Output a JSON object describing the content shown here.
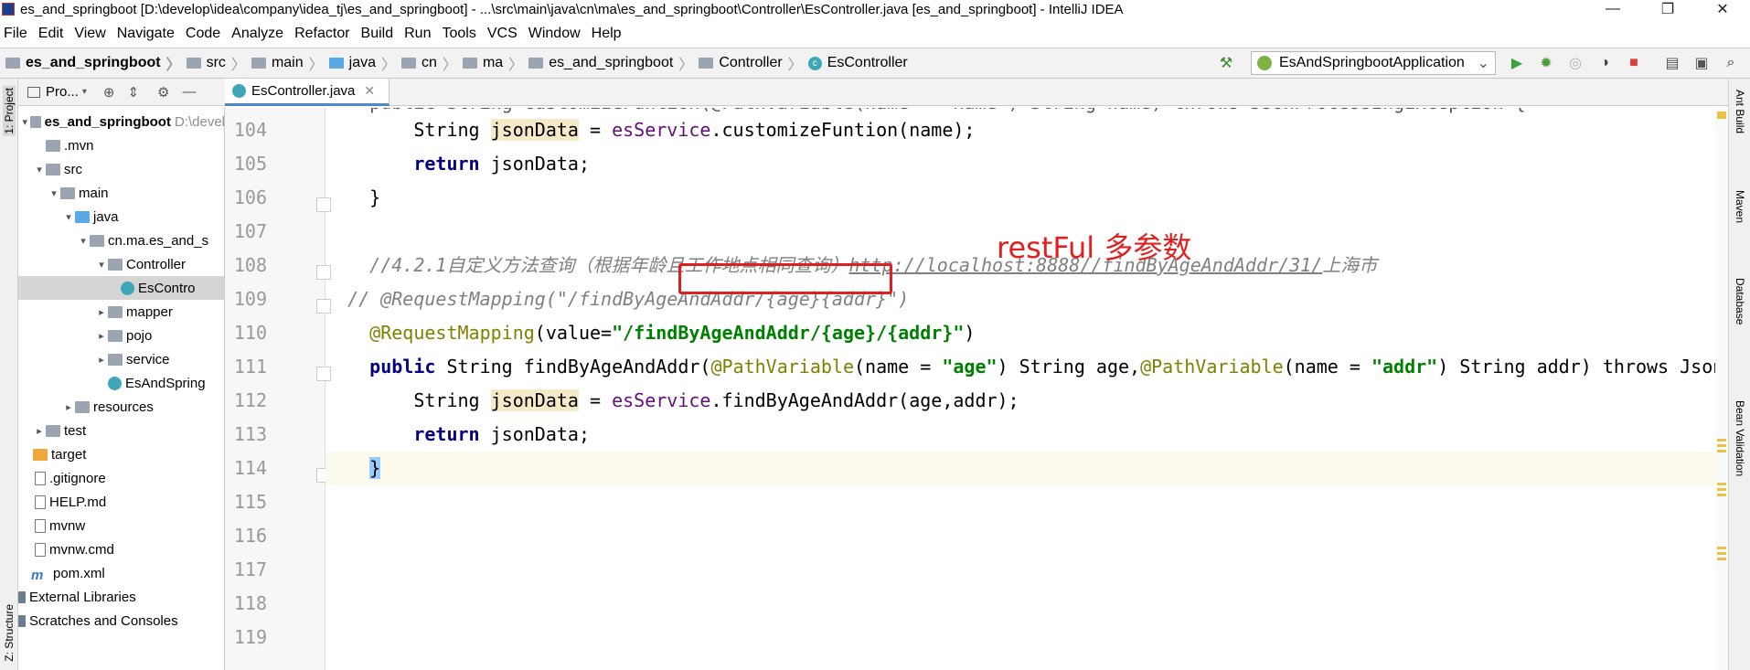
{
  "window": {
    "title": "es_and_springboot [D:\\develop\\idea\\company\\idea_tj\\es_and_springboot] - ...\\src\\main\\java\\cn\\ma\\es_and_springboot\\Controller\\EsController.java [es_and_springboot] - IntelliJ IDEA",
    "minimize": "—",
    "maximize": "❐",
    "close": "✕"
  },
  "menu": [
    "File",
    "Edit",
    "View",
    "Navigate",
    "Code",
    "Analyze",
    "Refactor",
    "Build",
    "Run",
    "Tools",
    "VCS",
    "Window",
    "Help"
  ],
  "breadcrumb": [
    "es_and_springboot",
    "src",
    "main",
    "java",
    "cn",
    "ma",
    "es_and_springboot",
    "Controller",
    "EsController"
  ],
  "run_config": "EsAndSpringbootApplication",
  "side_tabs": {
    "left_top": "1: Project",
    "left_bottom": "Z: Structure",
    "right": [
      "Ant Build",
      "Maven",
      "Database",
      "Bean Validation"
    ]
  },
  "project_panel": {
    "header": "Pro...",
    "tree": [
      {
        "label": "es_and_springboot",
        "extra": "D:\\devel",
        "level": 0,
        "icon": "folder",
        "arrow": "▾",
        "bold": true
      },
      {
        "label": ".mvn",
        "level": 1,
        "icon": "folder",
        "arrow": ""
      },
      {
        "label": "src",
        "level": 1,
        "icon": "folder",
        "arrow": "▾"
      },
      {
        "label": "main",
        "level": 2,
        "icon": "folder",
        "arrow": "▾"
      },
      {
        "label": "java",
        "level": 3,
        "icon": "folder-blue",
        "arrow": "▾"
      },
      {
        "label": "cn.ma.es_and_s",
        "level": 4,
        "icon": "folder",
        "arrow": "▾"
      },
      {
        "label": "Controller",
        "level": 5,
        "icon": "folder",
        "arrow": "▾"
      },
      {
        "label": "EsContro",
        "level": 6,
        "icon": "class",
        "arrow": "",
        "selected": true
      },
      {
        "label": "mapper",
        "level": 5,
        "icon": "folder",
        "arrow": "▸"
      },
      {
        "label": "pojo",
        "level": 5,
        "icon": "folder",
        "arrow": "▸"
      },
      {
        "label": "service",
        "level": 5,
        "icon": "folder",
        "arrow": "▸"
      },
      {
        "label": "EsAndSpring",
        "level": 5,
        "icon": "class",
        "arrow": ""
      },
      {
        "label": "resources",
        "level": 3,
        "icon": "folder",
        "arrow": "▸"
      },
      {
        "label": "test",
        "level": 2,
        "icon": "folder",
        "arrow": "▸"
      },
      {
        "label": "target",
        "level": 1,
        "icon": "folder-orange",
        "arrow": ""
      },
      {
        "label": ".gitignore",
        "level": 1,
        "icon": "file",
        "arrow": ""
      },
      {
        "label": "HELP.md",
        "level": 1,
        "icon": "file",
        "arrow": ""
      },
      {
        "label": "mvnw",
        "level": 1,
        "icon": "file",
        "arrow": ""
      },
      {
        "label": "mvnw.cmd",
        "level": 1,
        "icon": "file",
        "arrow": ""
      },
      {
        "label": "pom.xml",
        "level": 1,
        "icon": "maven",
        "arrow": ""
      },
      {
        "label": "External Libraries",
        "level": 0,
        "icon": "lib",
        "arrow": "▸"
      },
      {
        "label": "Scratches and Consoles",
        "level": 0,
        "icon": "lib",
        "arrow": ""
      }
    ]
  },
  "editor": {
    "tab": "EsController.java",
    "line_numbers": [
      "104",
      "105",
      "106",
      "107",
      "108",
      "109",
      "110",
      "111",
      "112",
      "113",
      "114",
      "115",
      "116",
      "117",
      "118",
      "119"
    ],
    "code": {
      "l103": "    public String customizeFuntion(@PathVariable(name = \"name\") String name) throws JsonProcessingException {",
      "l104_a": "        String ",
      "l104_b": "jsonData",
      "l104_c": " = ",
      "l104_d": "esService",
      "l104_e": ".customizeFuntion(name);",
      "l105_a": "        ",
      "l105_b": "return",
      "l105_c": " jsonData;",
      "l106": "    }",
      "l108_a": "    //4.2.1自定义方法查询（根据年龄且工作地点相同查询）",
      "l108_b": "http://localhost:8888//findByAgeAndAddr/31/",
      "l108_c": "上海市",
      "l109": "  // @RequestMapping(\"/findByAgeAndAddr/{age}{addr}\")",
      "l110_a": "    @RequestMapping",
      "l110_b": "(value=",
      "l110_c": "\"/findByAgeAndAddr/{age}/{addr}\"",
      "l110_d": ")",
      "l111_a": "    ",
      "l111_b": "public",
      "l111_c": " String findByAgeAndAddr(",
      "l111_d": "@PathVariable",
      "l111_e": "(name = ",
      "l111_f": "\"age\"",
      "l111_g": ") String age,",
      "l111_h": "@PathVariable",
      "l111_i": "(name = ",
      "l111_j": "\"addr\"",
      "l111_k": ") String addr) throws JsonProcessingException {",
      "l112_a": "        String ",
      "l112_b": "jsonData",
      "l112_c": " = ",
      "l112_d": "esService",
      "l112_e": ".findByAgeAndAddr(age,addr);",
      "l113_a": "        ",
      "l113_b": "return",
      "l113_c": " jsonData;",
      "l114_a": "    ",
      "l114_b": "}"
    }
  },
  "annotation": {
    "label": "restFul 多参数"
  }
}
